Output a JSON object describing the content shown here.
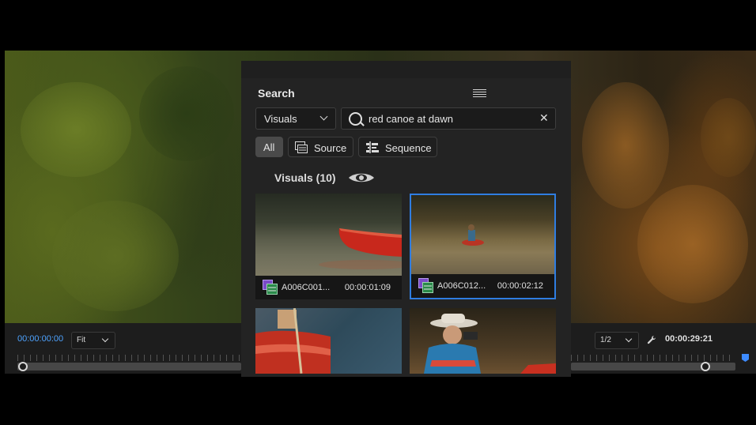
{
  "panel": {
    "title": "Search",
    "scope_select": "Visuals",
    "search_query": "red canoe at dawn",
    "filters": [
      "All",
      "Source",
      "Sequence"
    ],
    "section_label": "Visuals (10)"
  },
  "results": [
    {
      "name": "A006C001...",
      "duration": "00:00:01:09",
      "selected": false
    },
    {
      "name": "A006C012...",
      "duration": "00:00:02:12",
      "selected": true
    },
    {
      "name": "",
      "duration": "",
      "selected": false
    },
    {
      "name": "",
      "duration": "",
      "selected": false
    }
  ],
  "monitor": {
    "current_timecode": "00:00:00:00",
    "zoom": "Fit",
    "resolution": "1/2",
    "duration_timecode": "00:00:29:21"
  },
  "colors": {
    "accent_blue": "#2f7de1",
    "timecode_blue": "#4ea3ff",
    "panel_bg": "#232323",
    "canoe_red": "#c8281c"
  },
  "icons": [
    "hamburger-menu-icon",
    "chevron-down-icon",
    "search-icon",
    "close-icon",
    "source-clip-icon",
    "sequence-icon",
    "eye-icon",
    "clip-file-icon",
    "wrench-icon",
    "playhead-icon",
    "marker-icon"
  ]
}
